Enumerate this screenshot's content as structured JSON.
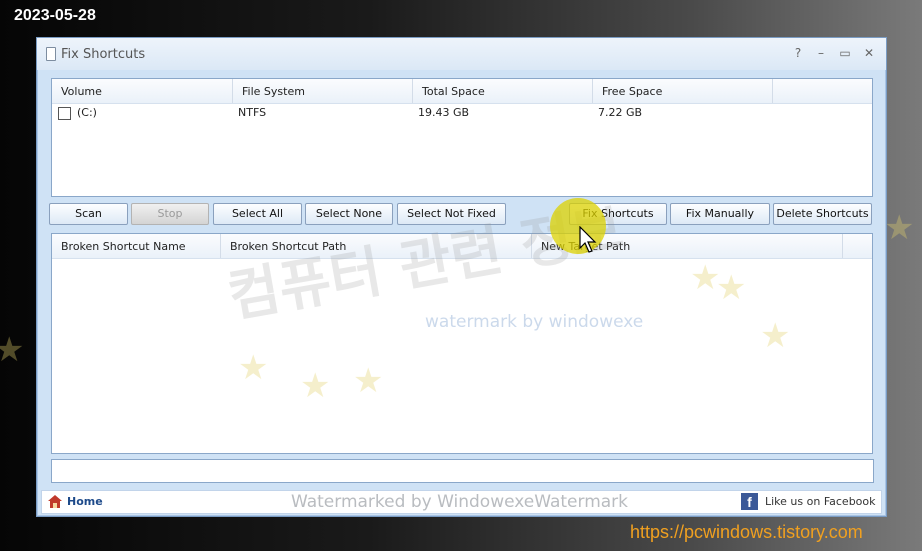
{
  "overlay": {
    "date": "2023-05-28",
    "site": "https://pcwindows.tistory.com"
  },
  "window": {
    "title": "Fix Shortcuts",
    "controls": {
      "help": "?",
      "minimize": "–",
      "maximize": "▭",
      "close": "✕"
    }
  },
  "volumes": {
    "columns": [
      "Volume",
      "File System",
      "Total Space",
      "Free Space"
    ],
    "rows": [
      {
        "checked": false,
        "volume": "(C:)",
        "file_system": "NTFS",
        "total": "19.43 GB",
        "free": "7.22 GB"
      }
    ]
  },
  "toolbar": {
    "scan": "Scan",
    "stop": "Stop",
    "select_all": "Select All",
    "select_none": "Select None",
    "select_not_fixed": "Select Not Fixed",
    "fix_shortcuts": "Fix Shortcuts",
    "fix_manually": "Fix Manually",
    "delete_shortcuts": "Delete Shortcuts"
  },
  "shortcuts": {
    "columns": [
      "Broken Shortcut Name",
      "Broken Shortcut Path",
      "New Target Path"
    ]
  },
  "footer": {
    "home": "Home",
    "facebook": "Like us on Facebook",
    "fb_letter": "f"
  },
  "watermarks": {
    "korean": "컴퓨터 관련 정보",
    "english": "watermark by windowexe",
    "footer": "Watermarked by WindowexeWatermark"
  },
  "colors": {
    "window_bg": "#cfe2f5",
    "facebook": "#3b5998",
    "site_link": "#f0a020"
  }
}
